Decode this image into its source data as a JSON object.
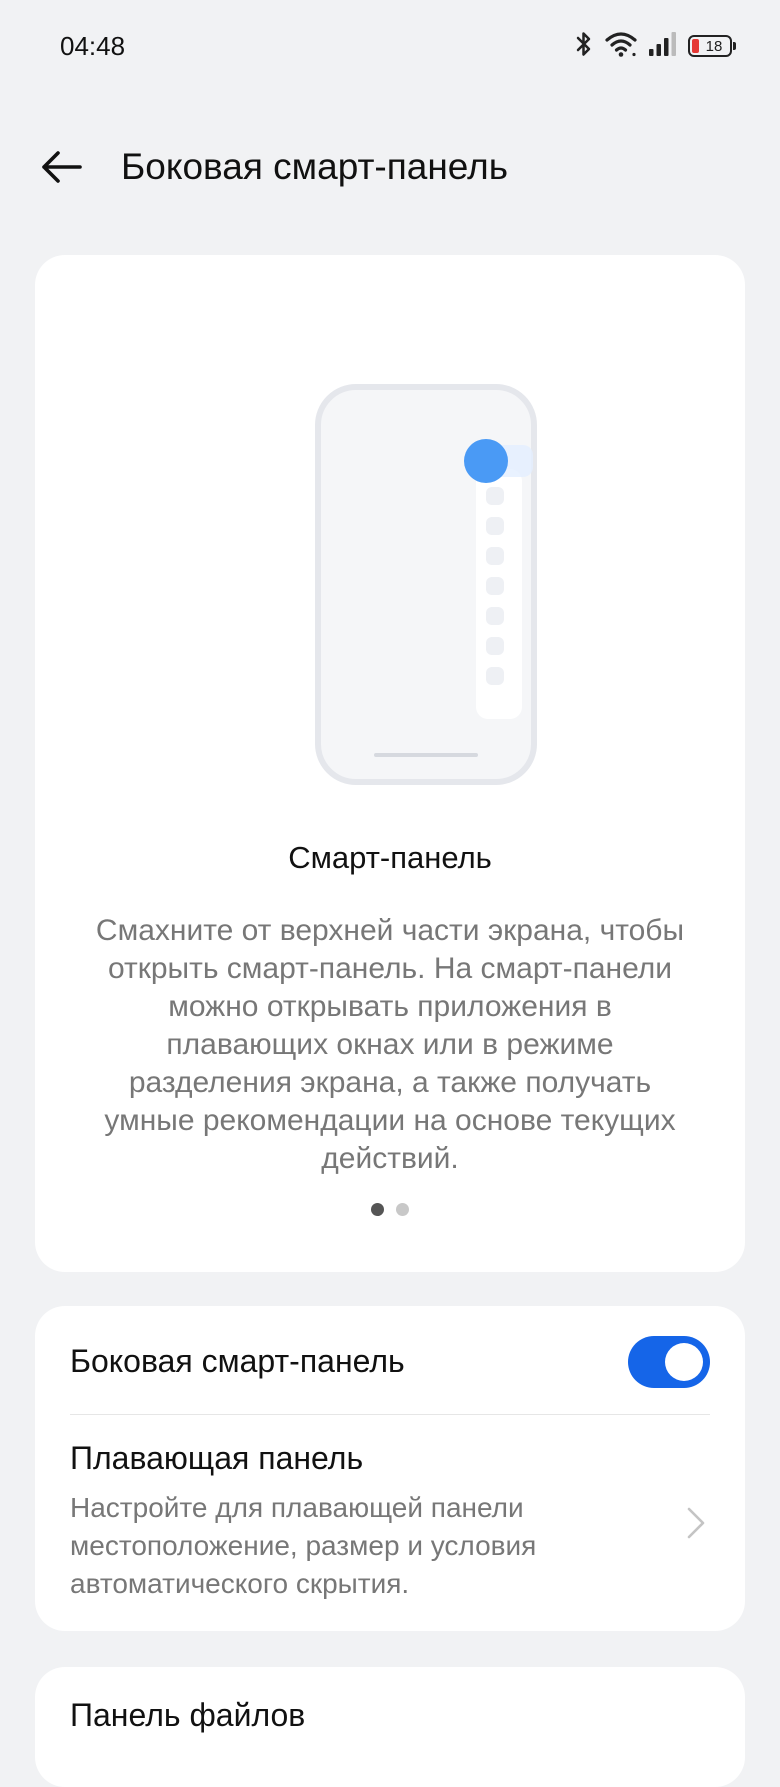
{
  "status_bar": {
    "time": "04:48",
    "battery_level": "18",
    "icons": [
      "bluetooth-icon",
      "wifi-icon",
      "signal-icon",
      "battery-icon"
    ]
  },
  "header": {
    "title": "Боковая смарт-панель",
    "back_icon": "arrow-left-icon"
  },
  "intro": {
    "title": "Смарт-панель",
    "description": "Смахните от верхней части экрана, чтобы открыть смарт-панель. На смарт-панели можно открывать приложения в плавающих окнах или в режиме разделения экрана, а также получать умные рекомендации на основе текущих действий.",
    "page_count": 2,
    "active_page": 1
  },
  "settings": {
    "smart_panel_label": "Боковая смарт-панель",
    "smart_panel_enabled": true,
    "floating_panel_title": "Плавающая панель",
    "floating_panel_description": "Настройте для плавающей панели местоположение, размер и условия автоматического скрытия."
  },
  "files_panel": {
    "title": "Панель файлов"
  },
  "colors": {
    "accent": "#1565e8",
    "illustration_dot": "#4a9af5",
    "background": "#f1f2f4"
  }
}
